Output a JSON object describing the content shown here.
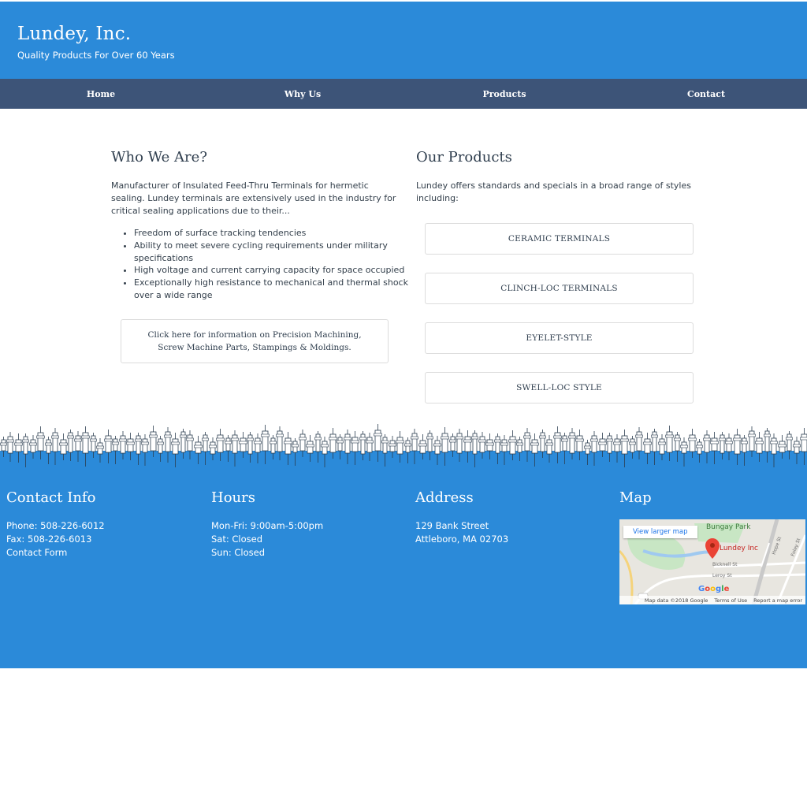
{
  "header": {
    "title": "Lundey, Inc.",
    "tagline": "Quality Products For Over 60 Years"
  },
  "nav": [
    "Home",
    "Why Us",
    "Products",
    "Contact"
  ],
  "who": {
    "heading": "Who We Are?",
    "intro": "Manufacturer of Insulated Feed-Thru Terminals for hermetic sealing. Lundey terminals are extensively used in the industry for critical sealing applications due to their...",
    "features": [
      "Freedom of surface tracking tendencies",
      "Ability to meet severe cycling requirements under military specifications",
      "High voltage and current carrying capacity for space occupied",
      "Exceptionally high resistance to mechanical and thermal shock over a wide range"
    ],
    "machining_link": "Click here for information on Precision Machining, Screw Machine Parts, Stampings & Moldings."
  },
  "products": {
    "heading": "Our Products",
    "intro": "Lundey offers standards and specials in a broad range of styles including:",
    "items": [
      "CERAMIC TERMINALS",
      "CLINCH-LOC TERMINALS",
      "EYELET-STYLE",
      "SWELL-LOC STYLE"
    ]
  },
  "footer": {
    "contact": {
      "heading": "Contact Info",
      "phone": "Phone: 508-226-6012",
      "fax": "Fax: 508-226-6013",
      "form": "Contact Form"
    },
    "hours": {
      "heading": "Hours",
      "lines": [
        "Mon-Fri: 9:00am-5:00pm",
        "Sat: Closed",
        "Sun: Closed"
      ]
    },
    "address": {
      "heading": "Address",
      "lines": [
        "129 Bank Street",
        "Attleboro, MA 02703"
      ]
    },
    "map": {
      "heading": "Map",
      "view_larger": "View larger map",
      "marker_label": "Lundey Inc",
      "park": "Bungay Park",
      "streets": [
        "Bicknell St",
        "Leroy St",
        "Foley St",
        "Hope St"
      ],
      "google": "Google",
      "map_data": "Map data ©2018 Google",
      "terms": "Terms of Use",
      "report": "Report a map error"
    }
  },
  "colors": {
    "header_blue": "#2b8ad9",
    "nav_navy": "#3d5478",
    "text_dark": "#2f3e4e",
    "marker_red": "#ea4335"
  },
  "icons": [
    "map-marker-icon",
    "terminal-pin-icon"
  ]
}
